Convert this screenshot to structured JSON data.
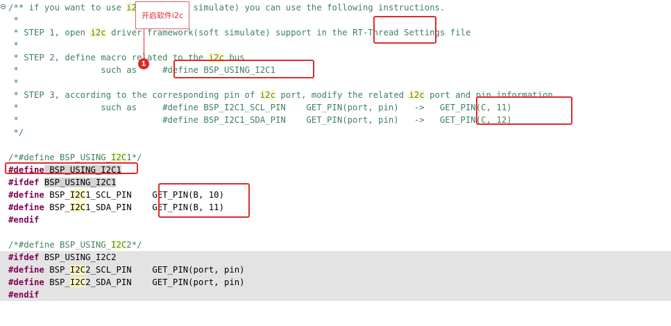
{
  "annotation": {
    "callout_text": "开启软件i2c",
    "marker_number": "1",
    "accent_color": "#e0282a"
  },
  "code": {
    "l1a": "/** if you want to use ",
    "l1k": "i2c",
    "l1b": " bus(soft simulate) you can use the following instructions.",
    "l2": " *",
    "l3a": " * STEP 1, open ",
    "l3k": "i2c",
    "l3b": " driver framework(soft simulate) support in the ",
    "l3c": "RT-Thread",
    "l3d": " Settings file",
    "l4": " *",
    "l5a": " * STEP 2, define macro related to the ",
    "l5k": "i2c",
    "l5b": " bus",
    "l6a": " *                such as     ",
    "l6b": "#define BSP_USING_I2C1",
    "l7": " *",
    "l8a": " * STEP 3, according to the corresponding pin of ",
    "l8k1": "i2c",
    "l8b": " port, modify the related ",
    "l8k2": "i2c",
    "l8c": " port and pin information",
    "l9a": " *                such as     #define BSP_I2C1_SCL_PIN    GET_PIN(port, pin)   ->   ",
    "l9b": "GET_PIN(C, 11)",
    "l10a": " *                            #define BSP_I2C1_SDA_PIN    GET_PIN(port, pin)   ->   ",
    "l10b": "GET_PIN(C, 12)",
    "l11": " */",
    "l13a": "/*#define BSP_USING_",
    "l13k": "I2C",
    "l13b": "1*/",
    "l14d": "#define",
    "l14b": " BSP_USING_I2C1",
    "l15d": "#ifdef",
    "l15b": "BSP_USING_I2C1",
    "l16d": "#define",
    "l16a": " BSP_",
    "l16k": "I2C",
    "l16b": "1_SCL_PIN    GET_PIN(B, 10)",
    "l17d": "#define",
    "l17a": " BSP_",
    "l17k": "I2C",
    "l17b": "1_SDA_PIN    GET_PIN(B, 11)",
    "l18d": "#endif",
    "l20a": "/*#define BSP_USING_",
    "l20k": "I2C",
    "l20b": "2*/",
    "l21d": "#ifdef",
    "l21b": " BSP_USING_I2C2",
    "l22d": "#define",
    "l22a": " BSP_",
    "l22k": "I2C",
    "l22b": "2_SCL_PIN    GET_PIN(port, pin)",
    "l23d": "#define",
    "l23a": " BSP_",
    "l23k": "I2C",
    "l23b": "2_SDA_PIN    GET_PIN(port, pin)",
    "l24d": "#endif"
  }
}
